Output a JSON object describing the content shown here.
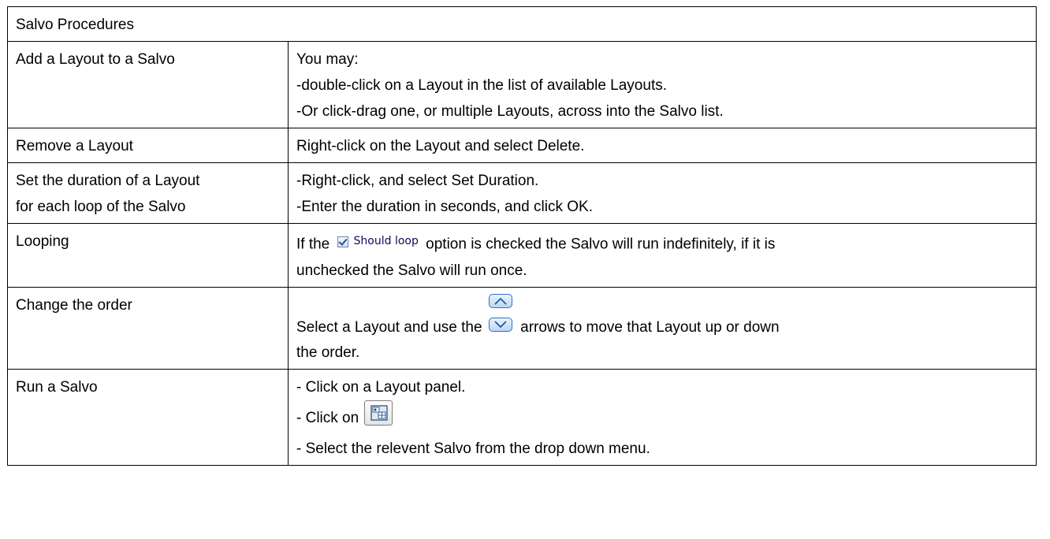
{
  "header": "Salvo Procedures",
  "rows": [
    {
      "label": "Add a Layout to a Salvo",
      "lines": [
        "You may:",
        "-double-click on a Layout in the list of available Layouts.",
        "-Or click-drag one, or multiple Layouts, across into the Salvo list."
      ]
    },
    {
      "label": "Remove a Layout",
      "lines": [
        "Right-click on the Layout and select Delete."
      ]
    },
    {
      "label_lines": [
        "Set the duration of a Layout",
        "for each loop of the Salvo"
      ],
      "lines": [
        "-Right-click, and select Set Duration.",
        "-Enter the duration in seconds, and click OK."
      ]
    },
    {
      "label": "Looping",
      "text_before": "If the",
      "checkbox_label": "Should loop",
      "text_after": "option is checked the Salvo will run indefinitely, if it is",
      "line2": "unchecked the Salvo will run once."
    },
    {
      "label": "Change the order",
      "text_before": "Select a Layout and use the",
      "text_after": "arrows to move that Layout up or down",
      "line2": "the order."
    },
    {
      "label": "Run a Salvo",
      "line1": "- Click on a Layout panel.",
      "click_on": "- Click on",
      "line3": "- Select the relevent Salvo from the drop down menu."
    }
  ],
  "icons": {
    "checkbox": "checkbox-checked-icon",
    "arrows": "up-down-arrows-icon",
    "salvo_button": "salvo-layout-button-icon"
  },
  "colors": {
    "border": "#000000",
    "checkbox_text": "#0c0c5a",
    "arrow_blue": "#2d70c8"
  }
}
